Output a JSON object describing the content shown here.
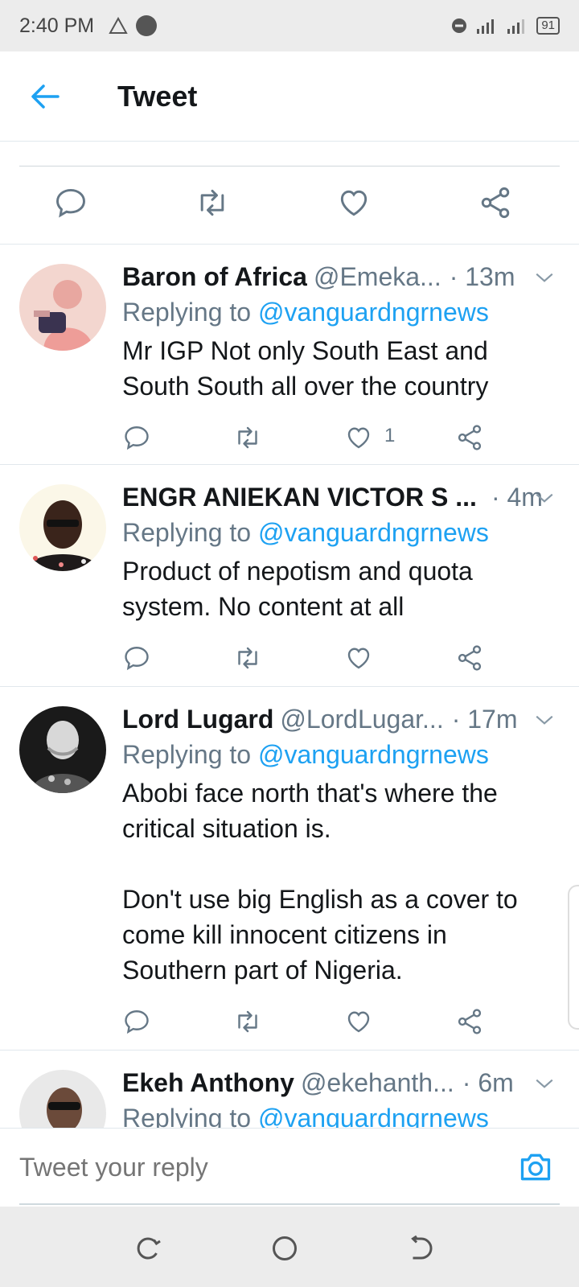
{
  "status_bar": {
    "time": "2:40 PM",
    "battery": "91"
  },
  "app_bar": {
    "title": "Tweet"
  },
  "replies": [
    {
      "name": "Baron of Africa",
      "handle": "@Emeka...",
      "time": "· 13m",
      "replying_prefix": "Replying to ",
      "replying_to": "@vanguardngrnews",
      "text": "Mr IGP Not only South East and South South all over the country",
      "like_count": "1"
    },
    {
      "name": "ENGR ANIEKAN VICTOR S ...",
      "handle": "",
      "time": "· 4m",
      "replying_prefix": "Replying to ",
      "replying_to": "@vanguardngrnews",
      "text": "Product of nepotism and quota system. No content at all",
      "like_count": ""
    },
    {
      "name": "Lord Lugard",
      "handle": "@LordLugar...",
      "time": "· 17m",
      "replying_prefix": "Replying to ",
      "replying_to": "@vanguardngrnews",
      "text": "Abobi face north that's where the critical situation is.\n\nDon't use big English as a cover to come kill innocent citizens in Southern part of Nigeria.",
      "like_count": ""
    },
    {
      "name": "Ekeh Anthony",
      "handle": "@ekehanth...",
      "time": "· 6m",
      "replying_prefix": "Replying to ",
      "replying_to": "@vanguardngrnews",
      "text": "",
      "like_count": ""
    }
  ],
  "reply_bar": {
    "placeholder": "Tweet your reply"
  },
  "colors": {
    "accent": "#1da1f2",
    "secondary_text": "#657786",
    "divider": "#e1e8ed"
  }
}
